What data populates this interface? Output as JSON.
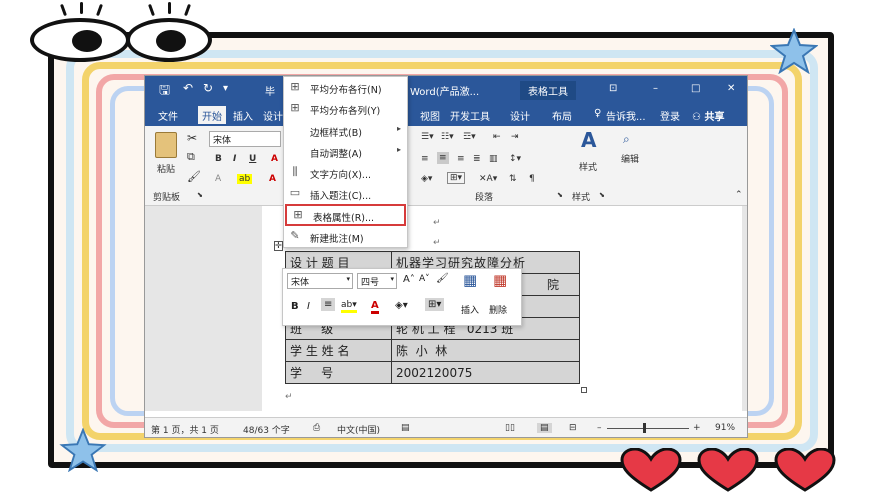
{
  "window": {
    "title": "Word(产品激...",
    "tool_tab": "表格工具",
    "title_left": "毕"
  },
  "title_buttons": [
    "⊡",
    "–",
    "□",
    "✕"
  ],
  "tabs": [
    "文件",
    "开始",
    "插入",
    "设计",
    "",
    "",
    "",
    "",
    "视图",
    "开发工具",
    "设计",
    "布局"
  ],
  "tab_right": {
    "tell_me": "告诉我...",
    "login": "登录",
    "share": "共享"
  },
  "ribbon": {
    "font_name": "宋体",
    "paste": "粘贴",
    "clipboard": "剪贴板",
    "paragraph": "段落",
    "styles": "样式",
    "styles_group": "样式",
    "edit": "编辑"
  },
  "context_menu": [
    {
      "label": "平均分布各行(N)",
      "icon": "distribute-rows-icon",
      "glyph": "⊞",
      "arrow": ""
    },
    {
      "label": "平均分布各列(Y)",
      "icon": "distribute-columns-icon",
      "glyph": "⊞",
      "arrow": ""
    },
    {
      "label": "边框样式(B)",
      "icon": "",
      "glyph": "",
      "arrow": "▸"
    },
    {
      "label": "自动调整(A)",
      "icon": "",
      "glyph": "",
      "arrow": "▸"
    },
    {
      "label": "文字方向(X)...",
      "icon": "text-direction-icon",
      "glyph": "⫼",
      "arrow": ""
    },
    {
      "label": "插入题注(C)...",
      "icon": "insert-caption-icon",
      "glyph": "▭",
      "arrow": ""
    },
    {
      "label": "表格属性(R)...",
      "icon": "table-properties-icon",
      "glyph": "⊞",
      "arrow": ""
    },
    {
      "label": "新建批注(M)",
      "icon": "new-comment-icon",
      "glyph": "✎",
      "arrow": ""
    }
  ],
  "mini_toolbar": {
    "font": "宋体",
    "size": "四号",
    "insert": "插入",
    "delete": "删除"
  },
  "table_rows": [
    [
      "设 计 题 目",
      "机器学习研究故障分析"
    ],
    [
      "",
      "院"
    ],
    [
      "",
      ""
    ],
    [
      "班     级",
      "轮 机 工 程   0213 班"
    ],
    [
      "学 生 姓 名",
      "陈  小  林"
    ],
    [
      "学     号",
      "2002120075"
    ]
  ],
  "status": {
    "page": "第 1 页，共 1 页",
    "words": "48/63 个字",
    "lang": "中文(中国)",
    "zoom": "91%"
  }
}
